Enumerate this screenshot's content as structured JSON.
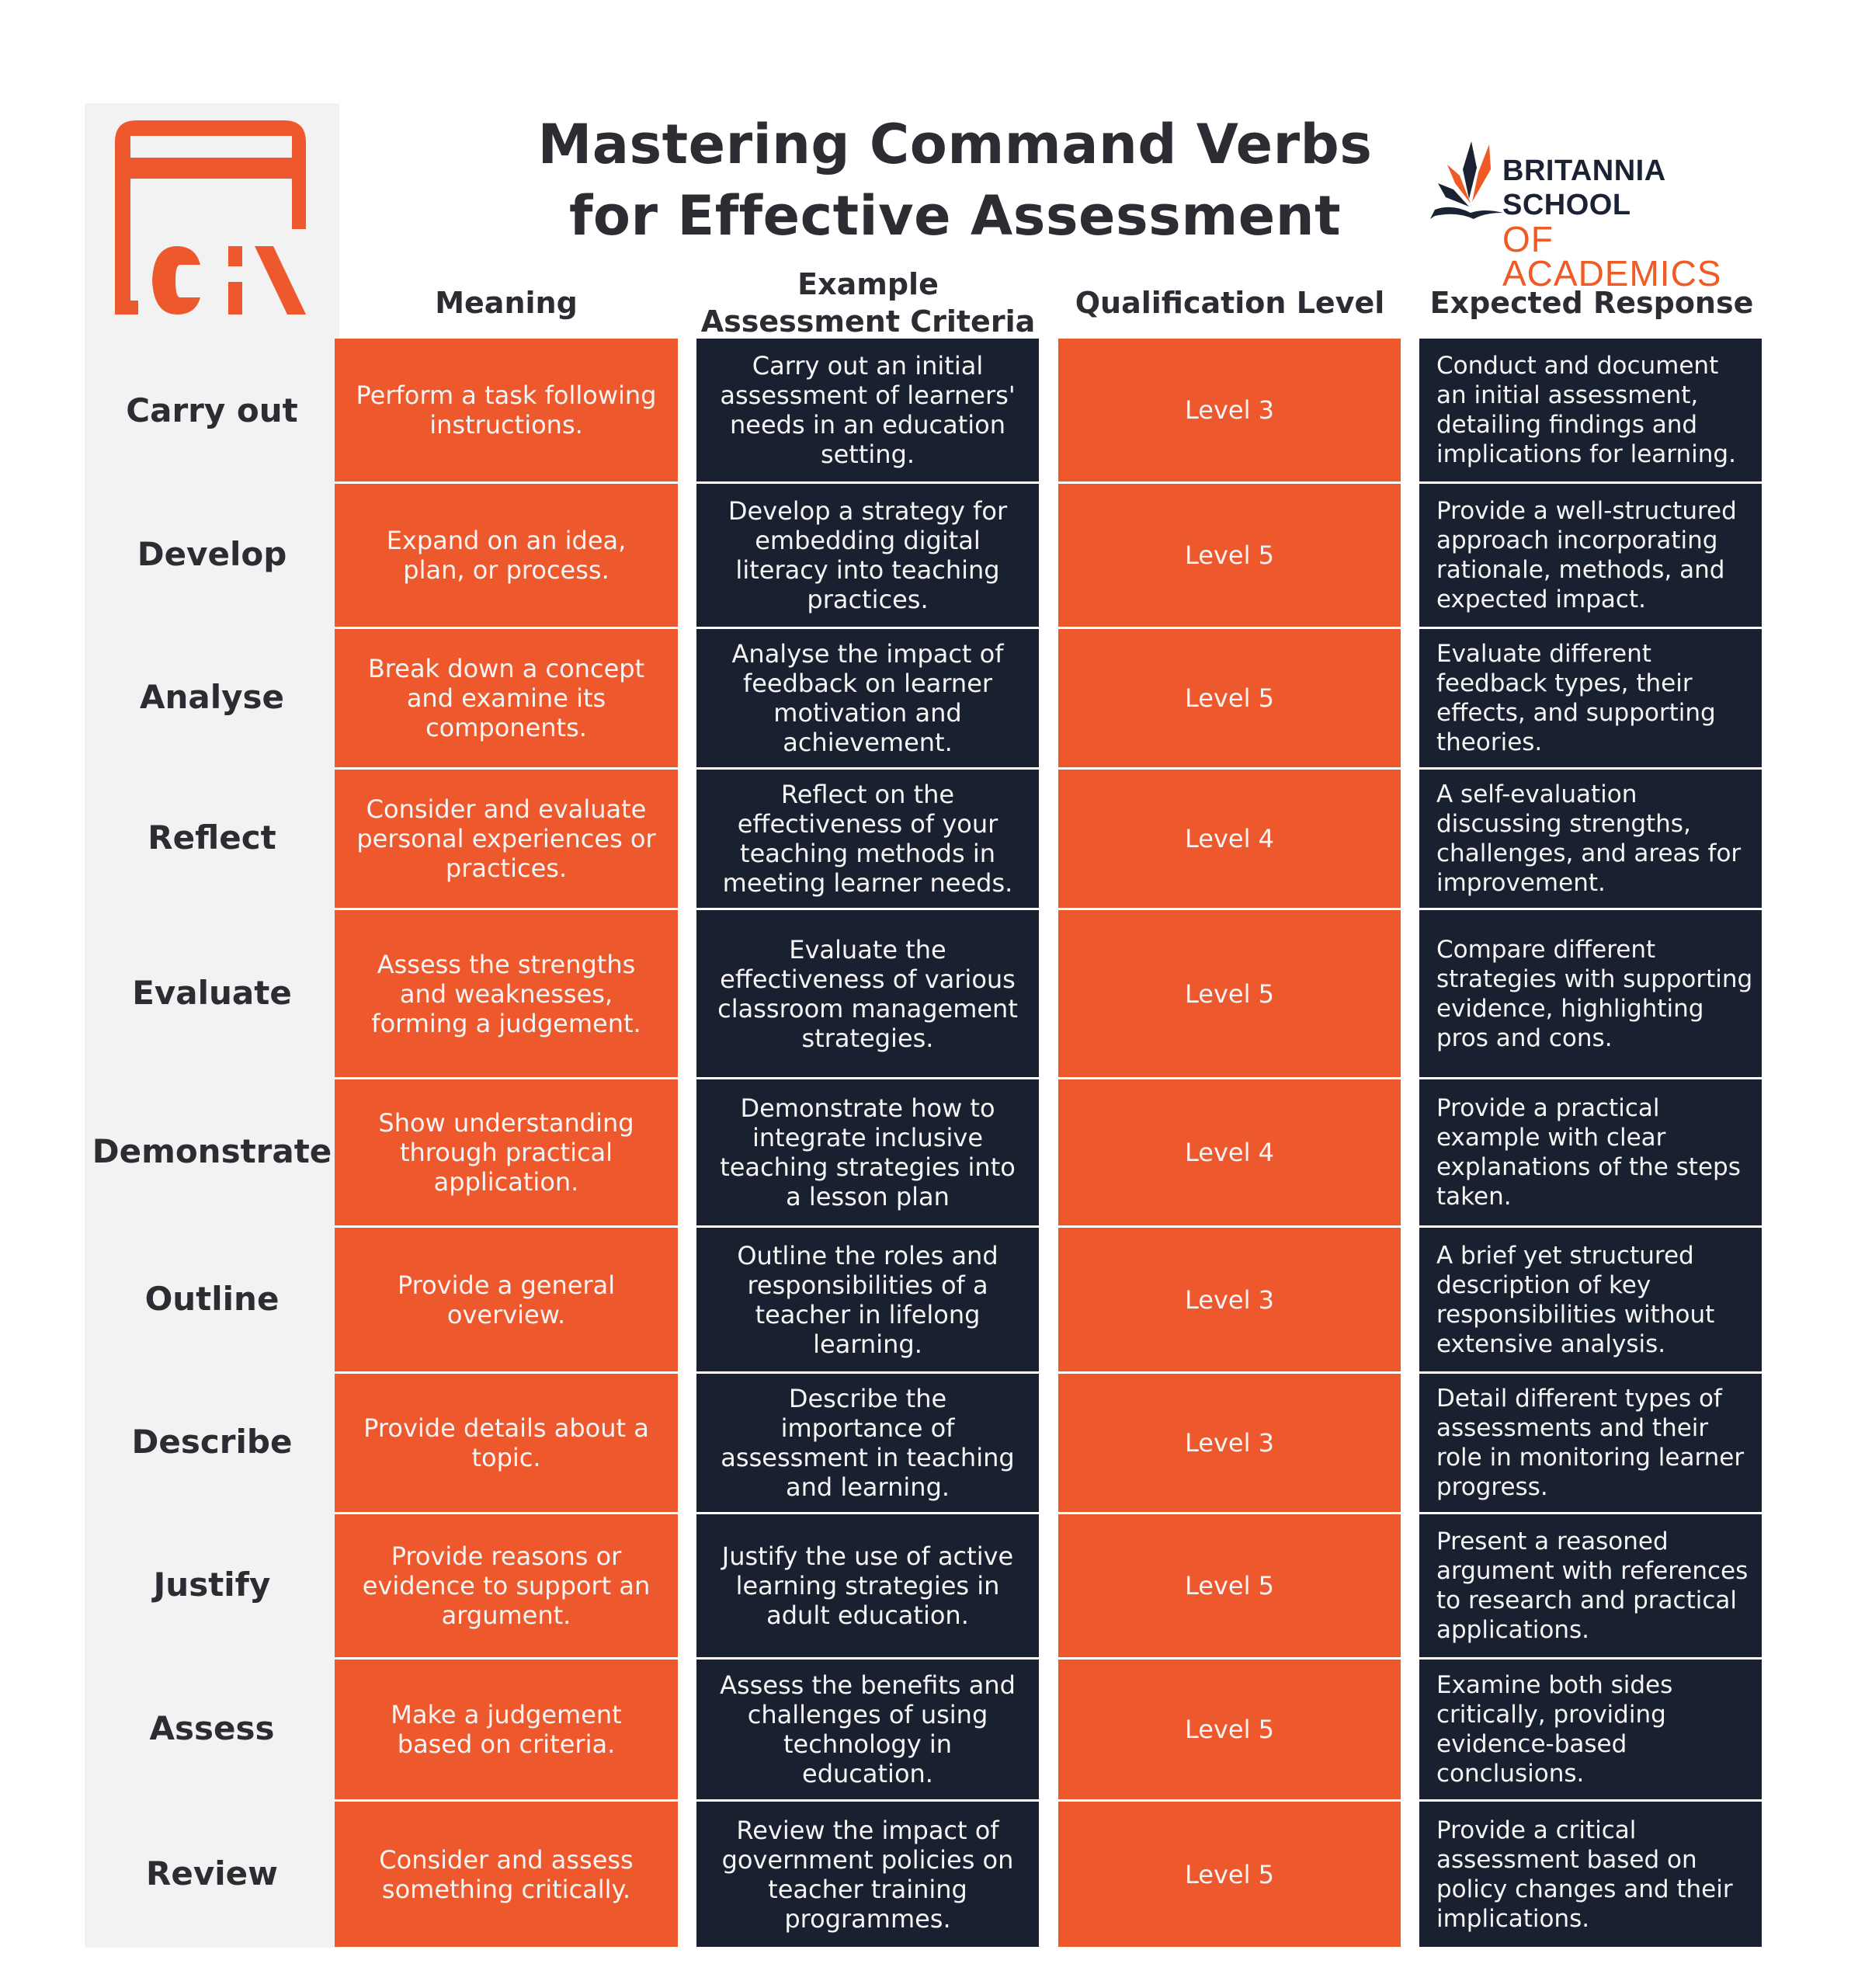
{
  "title": {
    "line1": "Mastering Command Verbs",
    "line2": "for Effective Assessment"
  },
  "brand": {
    "line1": "BRITANNIA SCHOOL",
    "line2": "OF ACADEMICS",
    "icon": "open-book-flame-icon"
  },
  "logo": {
    "icon": "bsa-monogram-logo",
    "color": "#ee582d"
  },
  "colors": {
    "orange": "#ee582d",
    "navy": "#19202f",
    "sidebar": "#f2f2f2",
    "text": "#2b2d33"
  },
  "columns": [
    {
      "label": "Meaning"
    },
    {
      "label": "Example Assessment Criteria",
      "line1": "Example",
      "line2": "Assessment Criteria"
    },
    {
      "label": "Qualification Level"
    },
    {
      "label": "Expected Response"
    }
  ],
  "rows": [
    {
      "verb": "Carry out",
      "meaning": "Perform a task following instructions.",
      "example": "Carry out an initial assessment of learners' needs in an education setting.",
      "level": "Level 3",
      "response": "Conduct and document an initial assessment, detailing findings and implications for learning."
    },
    {
      "verb": "Develop",
      "meaning": "Expand on an idea, plan, or process.",
      "example": "Develop a strategy for embedding digital literacy into teaching practices.",
      "level": "Level 5",
      "response": "Provide a well-structured approach incorporating rationale, methods, and expected impact."
    },
    {
      "verb": "Analyse",
      "meaning": "Break down a concept and examine its components.",
      "example": "Analyse the impact of feedback on learner motivation and achievement.",
      "level": "Level 5",
      "response": "Evaluate different feedback types, their effects, and supporting theories."
    },
    {
      "verb": "Reflect",
      "meaning": "Consider and evaluate personal experiences or practices.",
      "example": "Reflect on the effectiveness of your teaching methods in meeting learner needs.",
      "level": "Level 4",
      "response": "A self-evaluation discussing strengths, challenges, and areas for improvement."
    },
    {
      "verb": "Evaluate",
      "meaning": "Assess the strengths and weaknesses, forming a judgement.",
      "example": "Evaluate the effectiveness of various classroom management strategies.",
      "level": "Level 5",
      "response": "Compare different strategies with supporting evidence, highlighting pros and cons."
    },
    {
      "verb": "Demonstrate",
      "meaning": "Show understanding through practical application.",
      "example": "Demonstrate how to integrate inclusive teaching strategies into a lesson plan",
      "level": "Level 4",
      "response": "Provide a practical example with clear explanations of the steps taken."
    },
    {
      "verb": "Outline",
      "meaning": "Provide a general overview.",
      "example": "Outline the roles and responsibilities of a teacher in lifelong learning.",
      "level": "Level 3",
      "response": "A brief yet structured description of key responsibilities without extensive analysis."
    },
    {
      "verb": "Describe",
      "meaning": "Provide details about a topic.",
      "example": "Describe the importance of assessment in teaching and learning.",
      "level": "Level 3",
      "response": "Detail different types of assessments and their role in monitoring learner progress."
    },
    {
      "verb": "Justify",
      "meaning": "Provide reasons or evidence to support an argument.",
      "example": "Justify the use of active learning strategies in adult education.",
      "level": "Level 5",
      "response": "Present a reasoned argument with references to research and practical applications."
    },
    {
      "verb": "Assess",
      "meaning": "Make a judgement based on criteria.",
      "example": "Assess the benefits and challenges of using technology in education.",
      "level": "Level 5",
      "response": "Examine both sides critically, providing evidence-based conclusions."
    },
    {
      "verb": "Review",
      "meaning": "Consider and assess something critically.",
      "example": "Review the impact of government policies on teacher training programmes.",
      "level": "Level 5",
      "response": "Provide a critical assessment based on policy changes and their implications."
    }
  ]
}
